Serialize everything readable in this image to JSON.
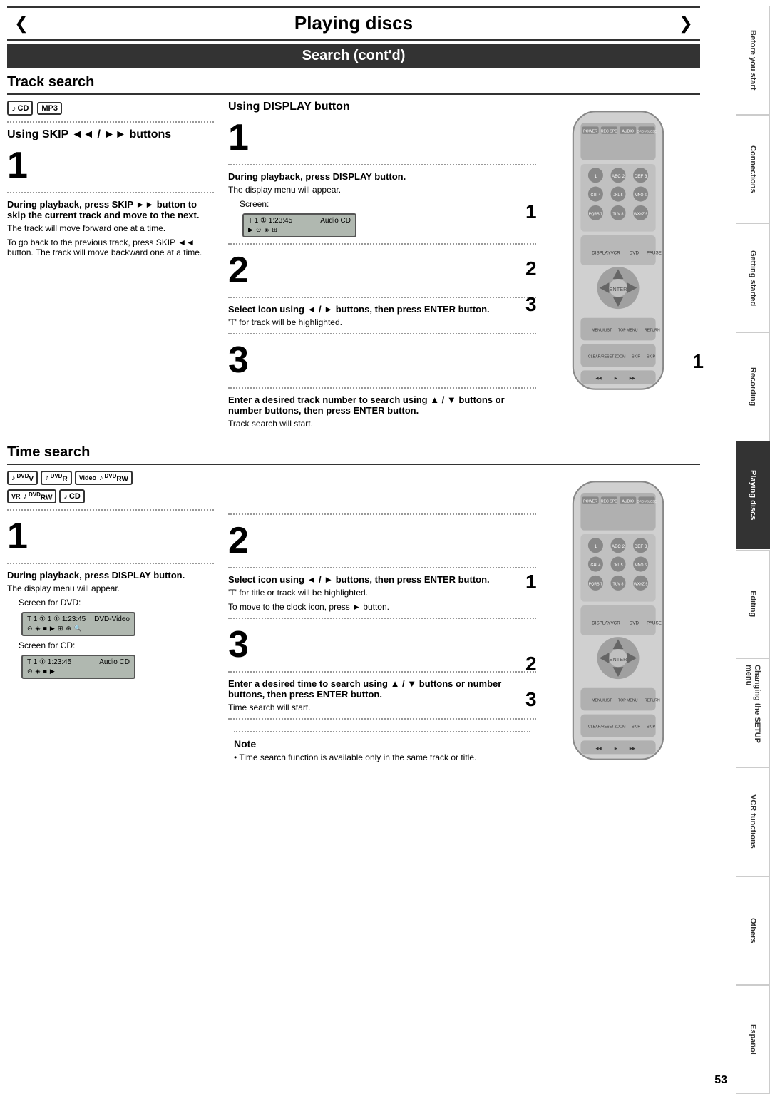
{
  "page": {
    "title": "Playing discs",
    "section_title": "Search (cont'd)",
    "page_number": "53"
  },
  "track_search": {
    "heading": "Track search",
    "left": {
      "using_heading": "Using SKIP ◄◄ / ►► buttons",
      "step1_number": "1",
      "step1_bold": "During playback, press SKIP ►► button to skip the current track and move to the next.",
      "step1_normal": "The track will move forward one at a time.",
      "step1_note": "To go back to the previous track, press SKIP ◄◄ button. The track will move backward one at a time."
    },
    "right": {
      "using_heading": "Using DISPLAY button",
      "step1_number": "1",
      "step1_bold": "During playback, press DISPLAY button.",
      "step1_normal1": "The display menu will appear.",
      "step1_normal2": "Screen:",
      "screen1_left": "T  1  ①  1:23:45",
      "screen1_right": "Audio CD",
      "step2_number": "2",
      "step2_bold": "Select  icon using ◄ / ► buttons, then press ENTER button.",
      "step2_normal": "'T' for track will be highlighted.",
      "step3_number": "3",
      "step3_bold": "Enter a desired track number to search using ▲ / ▼ buttons or number buttons, then press ENTER button.",
      "step3_normal": "Track search will start."
    }
  },
  "time_search": {
    "heading": "Time search",
    "left": {
      "step1_number": "1",
      "step1_bold": "During playback, press DISPLAY button.",
      "step1_normal1": "The display menu will appear.",
      "step1_normal2": "Screen for DVD:",
      "screen_dvd_left": "T  1 ①  1  ①  1:23:45",
      "screen_dvd_right": "DVD-Video",
      "step1_normal3": "Screen for CD:"
    },
    "right": {
      "step2_number": "2",
      "step2_bold1": "Select  icon using ◄ / ► buttons, then press ENTER button.",
      "step2_normal1": "'T' for title or track will be highlighted.",
      "step2_normal2": "To move to the clock icon, press ► button.",
      "step3_number": "3",
      "step3_bold": "Enter a desired time to search using ▲ / ▼ buttons or number buttons, then press ENTER button.",
      "step3_normal": "Time search will start."
    },
    "note": {
      "title": "Note",
      "text": "• Time search function is available only in the same track or title."
    }
  },
  "sidebar": {
    "tabs": [
      {
        "label": "Before you start",
        "active": false
      },
      {
        "label": "Connections",
        "active": false
      },
      {
        "label": "Getting started",
        "active": false
      },
      {
        "label": "Recording",
        "active": false
      },
      {
        "label": "Playing discs",
        "active": true
      },
      {
        "label": "Editing",
        "active": false
      },
      {
        "label": "Changing the SETUP menu",
        "active": false
      },
      {
        "label": "VCR functions",
        "active": false
      },
      {
        "label": "Others",
        "active": false
      },
      {
        "label": "Español",
        "active": false
      }
    ]
  }
}
